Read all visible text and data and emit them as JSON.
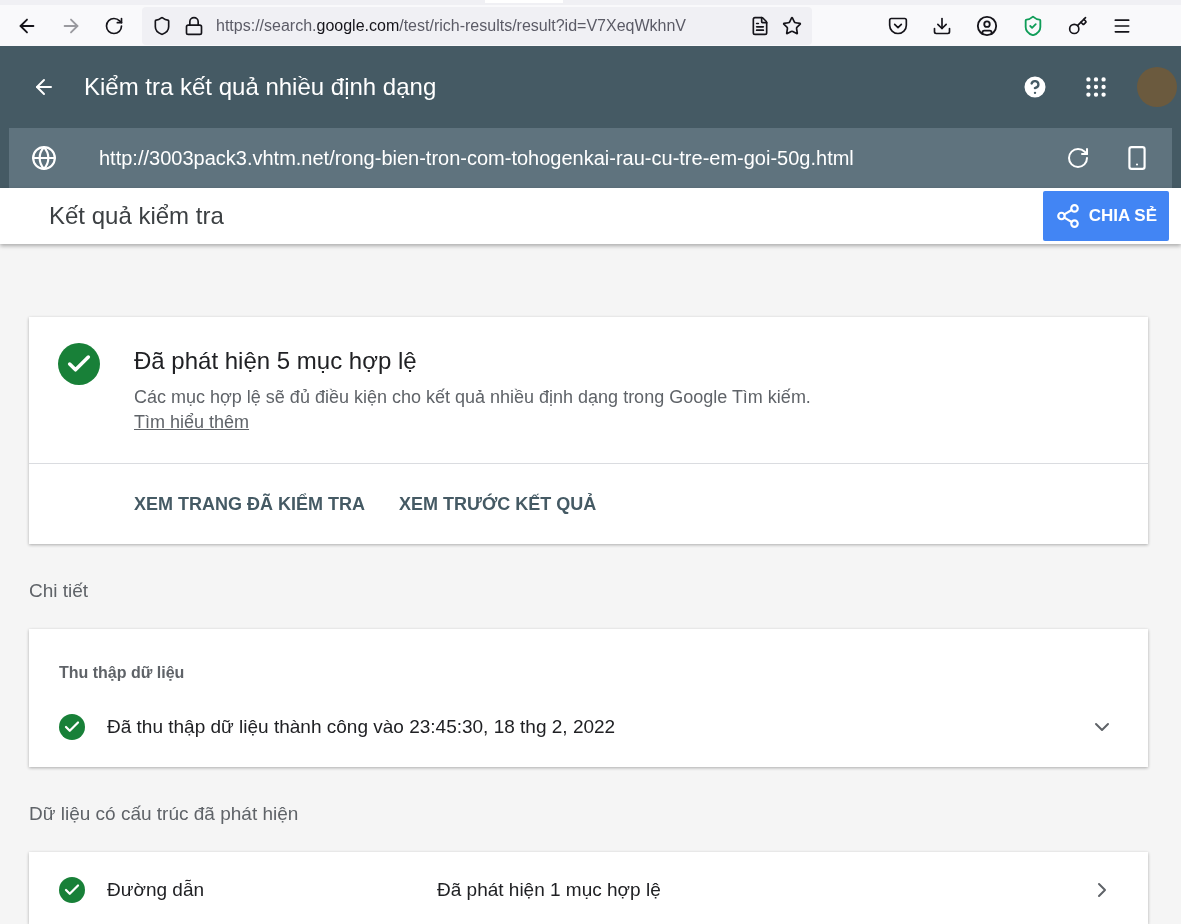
{
  "browser": {
    "url_prefix": "https://search.",
    "url_domain": "google.com",
    "url_suffix": "/test/rich-results/result?id=V7XeqWkhnV"
  },
  "app_bar": {
    "title": "Kiểm tra kết quả nhiều định dạng"
  },
  "url_bar": {
    "value": "http://3003pack3.vhtm.net/rong-bien-tron-com-tohogenkai-rau-cu-tre-em-goi-50g.html"
  },
  "results_bar": {
    "title": "Kết quả kiểm tra",
    "share_button": "CHIA SẺ"
  },
  "summary": {
    "heading": "Đã phát hiện 5 mục hợp lệ",
    "description": "Các mục hợp lệ sẽ đủ điều kiện cho kết quả nhiều định dạng trong Google Tìm kiếm.",
    "link": "Tìm hiểu thêm",
    "actions": [
      "XEM TRANG ĐÃ KIỂM TRA",
      "XEM TRƯỚC KẾT QUẢ"
    ]
  },
  "details": {
    "heading": "Chi tiết",
    "card_title": "Thu thập dữ liệu",
    "status": "Đã thu thập dữ liệu thành công vào 23:45:30, 18 thg 2, 2022",
    "expanded": false
  },
  "structured": {
    "heading": "Dữ liệu có cấu trúc đã phát hiện",
    "rows": [
      {
        "name": "Đường dẫn",
        "result": "Đã phát hiện 1 mục hợp lệ"
      }
    ]
  }
}
